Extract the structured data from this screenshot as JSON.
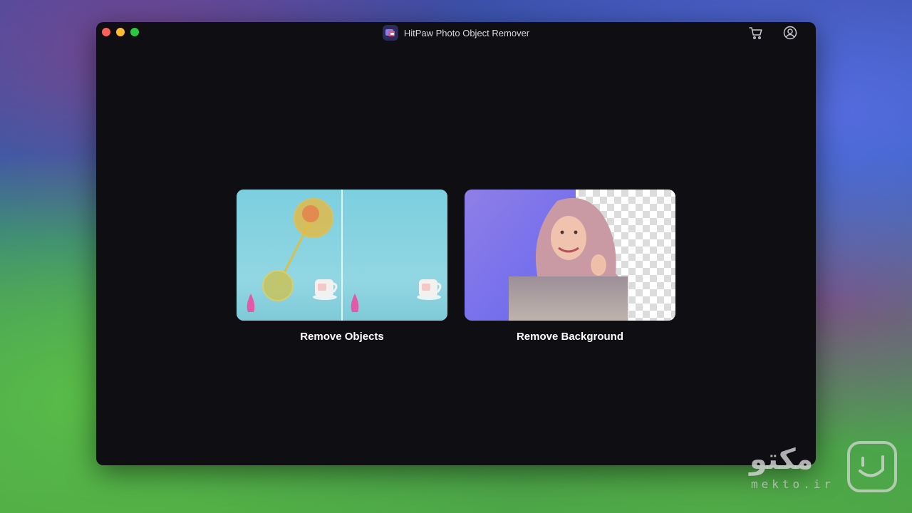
{
  "window": {
    "title": "HitPaw Photo Object Remover",
    "controls": [
      "close",
      "minimize",
      "zoom"
    ],
    "toolbar_icons": [
      "cart-icon",
      "account-icon"
    ]
  },
  "cards": [
    {
      "label": "Remove Objects"
    },
    {
      "label": "Remove Background"
    }
  ],
  "watermark": {
    "text": "مکتو",
    "subtext": "mekto.ir"
  },
  "colors": {
    "window_bg": "#0e0e13",
    "close": "#fe5f57",
    "minimize": "#febc2e",
    "zoom": "#28c840",
    "objects_card_bg": "#8ed5e1",
    "background_card_accent": "#6b6ef5"
  }
}
